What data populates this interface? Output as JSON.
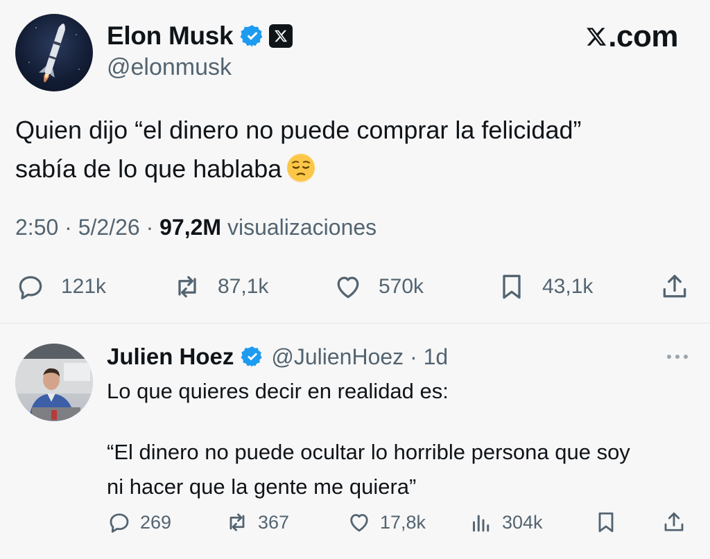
{
  "main_tweet": {
    "author": {
      "display_name": "Elon Musk",
      "handle": "@elonmusk"
    },
    "brand": "X.com",
    "text_lines": [
      "Quien dijo “el dinero no puede comprar la felicidad”",
      "sabía de lo que hablaba"
    ],
    "emoji": "pensive-face",
    "time": "2:50",
    "date": "5/2/26",
    "separator": "·",
    "views_count": "97,2M",
    "views_label": "visualizaciones",
    "stats": {
      "replies": "121k",
      "reposts": "87,1k",
      "likes": "570k",
      "bookmarks": "43,1k"
    }
  },
  "reply": {
    "author": {
      "display_name": "Julien Hoez",
      "handle": "@JulienHoez · 1d"
    },
    "text_lines": [
      "Lo que quieres decir en realidad es:",
      "“El dinero no puede ocultar lo horrible persona que soy",
      "ni hacer que la gente me quiera”"
    ],
    "stats": {
      "replies": "269",
      "reposts": "367",
      "likes": "17,8k",
      "views": "304k"
    }
  },
  "colors": {
    "background": "#f7f7f7",
    "text_primary": "#0f1419",
    "text_secondary": "#536471",
    "verified_blue": "#1d9bf0"
  }
}
